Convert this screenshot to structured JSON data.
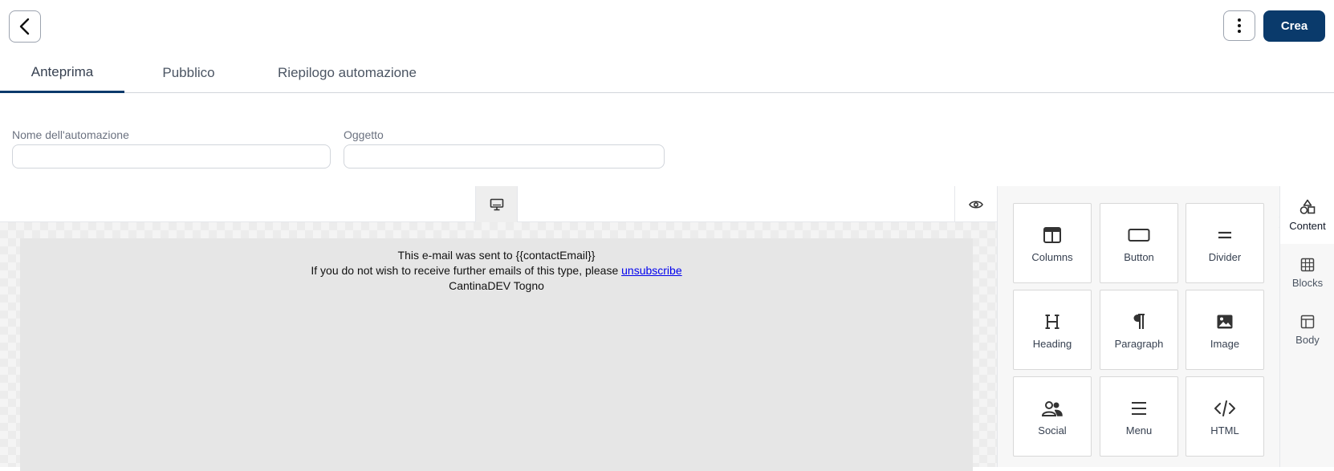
{
  "header": {
    "create_label": "Crea"
  },
  "tabs": [
    {
      "label": "Anteprima",
      "active": true
    },
    {
      "label": "Pubblico",
      "active": false
    },
    {
      "label": "Riepilogo automazione",
      "active": false
    }
  ],
  "form": {
    "name_label": "Nome dell'automazione",
    "name_value": "",
    "subject_label": "Oggetto",
    "subject_value": ""
  },
  "email": {
    "line1": "This e-mail was sent to {{contactEmail}}",
    "line2_prefix": "If you do not wish to receive further emails of this type, please ",
    "unsubscribe_label": "unsubscribe",
    "line3": "CantinaDEV Togno"
  },
  "content_tiles": [
    {
      "label": "Columns",
      "icon": "columns-icon"
    },
    {
      "label": "Button",
      "icon": "button-icon"
    },
    {
      "label": "Divider",
      "icon": "divider-icon"
    },
    {
      "label": "Heading",
      "icon": "heading-icon"
    },
    {
      "label": "Paragraph",
      "icon": "paragraph-icon"
    },
    {
      "label": "Image",
      "icon": "image-icon"
    },
    {
      "label": "Social",
      "icon": "social-icon"
    },
    {
      "label": "Menu",
      "icon": "menu-icon"
    },
    {
      "label": "HTML",
      "icon": "html-icon"
    }
  ],
  "side_tabs": [
    {
      "label": "Content",
      "icon": "shapes-icon",
      "active": true
    },
    {
      "label": "Blocks",
      "icon": "blocks-icon",
      "active": false
    },
    {
      "label": "Body",
      "icon": "body-layout-icon",
      "active": false
    }
  ],
  "colors": {
    "primary": "#0a3a6b",
    "canvas_body": "#e6e6e6",
    "link": "#0000ee"
  }
}
